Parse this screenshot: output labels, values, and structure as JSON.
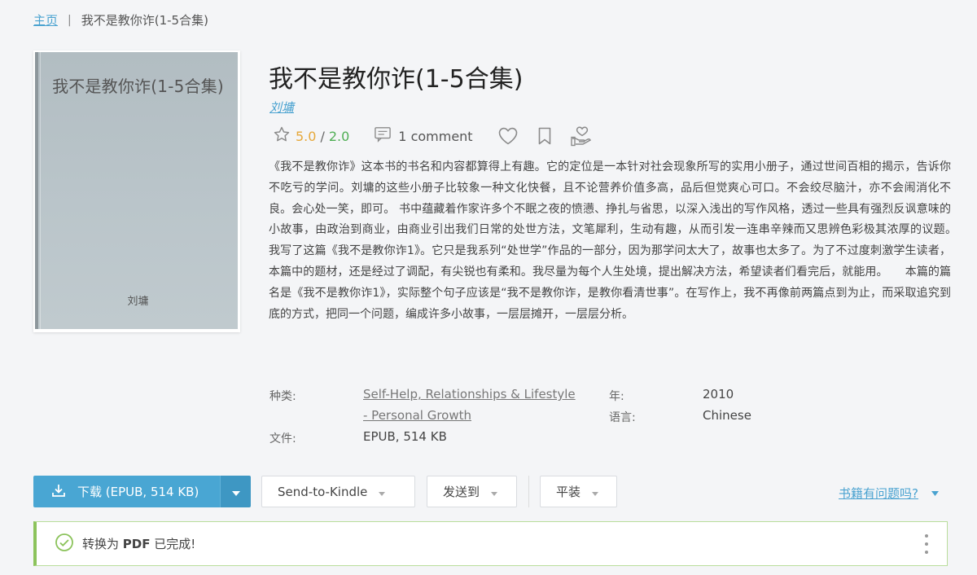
{
  "breadcrumb": {
    "home": "主页",
    "separator": "|",
    "current": "我不是教你诈(1-5合集)"
  },
  "cover": {
    "title": "我不是教你诈(1-5合集)",
    "author": "刘墉"
  },
  "book": {
    "title": "我不是教你诈(1-5合集)",
    "author": "刘墉",
    "rating_primary": "5.0",
    "rating_separator": "/",
    "rating_secondary": "2.0",
    "comments": "1 comment",
    "description": "《我不是教你诈》这本书的书名和内容都算得上有趣。它的定位是一本针对社会现象所写的实用小册子，通过世间百相的揭示，告诉你不吃亏的学问。刘墉的这些小册子比较象一种文化快餐，且不论营养价值多高，品后但觉爽心可口。不会绞尽脑汁，亦不会闹消化不良。会心处一笑，即可。 书中蕴藏着作家许多个不眠之夜的愤懑、挣扎与省思，以深入浅出的写作风格，透过一些具有强烈反讽意味的小故事，由政治到商业，由商业引出我们日常的处世方法，文笔犀利，生动有趣，从而引发一连串辛辣而又思辨色彩极其浓厚的议题。　　我写了这篇《我不是教你诈1》。它只是我系列“处世学”作品的一部分，因为那学问太大了，故事也太多了。为了不过度刺激学生读者，本篇中的题材，还是经过了调配，有尖锐也有柔和。我尽量为每个人生处境，提出解决方法，希望读者们看完后，就能用。　　本篇的篇名是《我不是教你诈1》，实际整个句子应该是“我不是教你诈，是教你看清世事”。在写作上，我不再像前两篇点到为止，而采取追究到底的方式，把同一个问题，编成许多小故事，一层层摊开，一层层分析。"
  },
  "properties": {
    "category_label": "种类:",
    "category_value_line1": "Self-Help, Relationships & Lifestyle",
    "category_value_line2": "- Personal Growth",
    "year_label": "年:",
    "year_value": "2010",
    "language_label": "语言:",
    "language_value": "Chinese",
    "file_label": "文件:",
    "file_value": "EPUB, 514 KB"
  },
  "actions": {
    "download_label": "下载 (EPUB, 514 KB)",
    "kindle_label": "Send-to-Kindle",
    "send_to_label": "发送到",
    "format_label": "平装",
    "report_label": "书籍有问题吗?"
  },
  "alert": {
    "prefix": "转换为",
    "format": "PDF",
    "suffix": "已完成!"
  },
  "colors": {
    "accent": "#49a6d3",
    "rating_gold": "#e6a83a",
    "rating_green": "#4fae54",
    "success": "#8cc35c"
  },
  "icons": {
    "rating": "star-outline-icon",
    "comment": "comment-icon",
    "like": "heart-outline-icon",
    "bookmark": "bookmark-outline-icon",
    "donate": "hand-donate-icon",
    "download": "download-icon",
    "success": "check-circle-icon",
    "more": "more-vertical-icon"
  }
}
